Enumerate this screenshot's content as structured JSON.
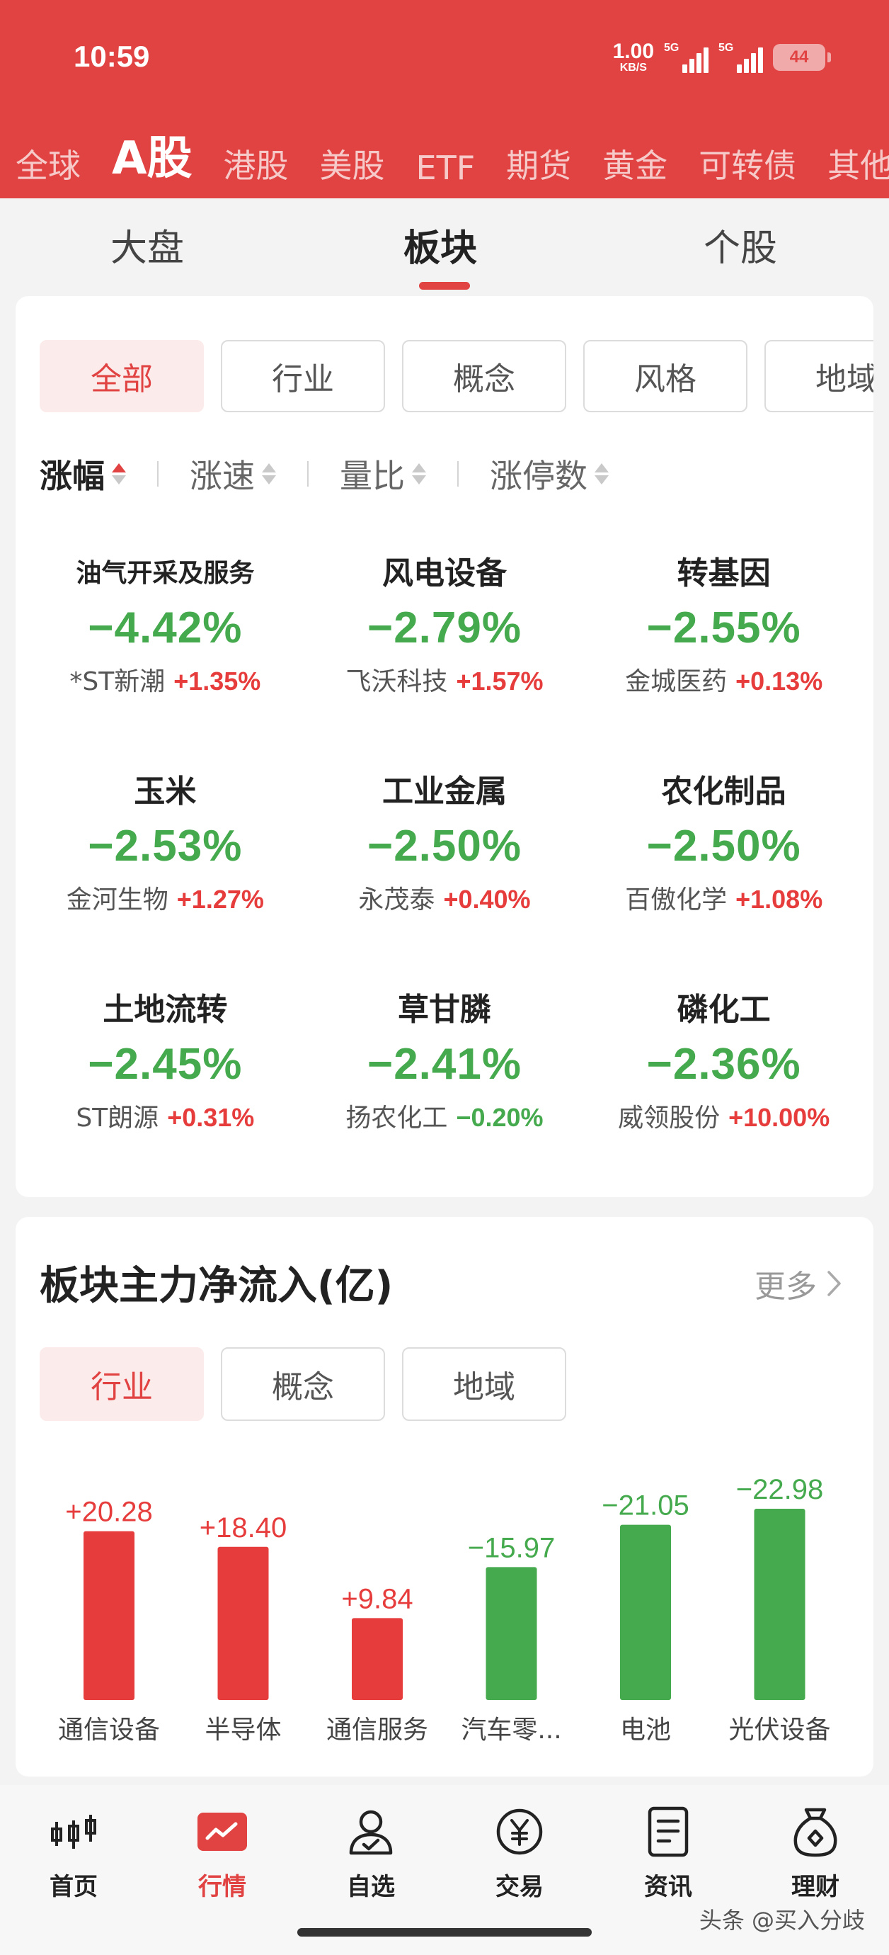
{
  "status_bar": {
    "time": "10:59",
    "net_speed_value": "1.00",
    "net_speed_unit": "KB/S",
    "signal1_label": "5G",
    "signal2_label": "5G",
    "battery": "44"
  },
  "market_tabs": [
    "全球",
    "A股",
    "港股",
    "美股",
    "ETF",
    "期货",
    "黄金",
    "可转债",
    "其他"
  ],
  "market_active": "A股",
  "sub_tabs": [
    "大盘",
    "板块",
    "个股"
  ],
  "sub_active": "板块",
  "filter_chips": [
    "全部",
    "行业",
    "概念",
    "风格",
    "地域"
  ],
  "sort_options": [
    "涨幅",
    "涨速",
    "量比",
    "涨停数"
  ],
  "sectors": [
    {
      "name": "油气开采及服务",
      "change": "−4.42%",
      "leader": "*ST新潮",
      "leader_change": "+1.35%"
    },
    {
      "name": "风电设备",
      "change": "−2.79%",
      "leader": "飞沃科技",
      "leader_change": "+1.57%"
    },
    {
      "name": "转基因",
      "change": "−2.55%",
      "leader": "金城医药",
      "leader_change": "+0.13%"
    },
    {
      "name": "玉米",
      "change": "−2.53%",
      "leader": "金河生物",
      "leader_change": "+1.27%"
    },
    {
      "name": "工业金属",
      "change": "−2.50%",
      "leader": "永茂泰",
      "leader_change": "+0.40%"
    },
    {
      "name": "农化制品",
      "change": "−2.50%",
      "leader": "百傲化学",
      "leader_change": "+1.08%"
    },
    {
      "name": "土地流转",
      "change": "−2.45%",
      "leader": "ST朗源",
      "leader_change": "+0.31%"
    },
    {
      "name": "草甘膦",
      "change": "−2.41%",
      "leader": "扬农化工",
      "leader_change": "−0.20%"
    },
    {
      "name": "磷化工",
      "change": "−2.36%",
      "leader": "威领股份",
      "leader_change": "+10.00%"
    }
  ],
  "flow_section": {
    "title": "板块主力净流入(亿)",
    "more": "更多",
    "chips": [
      "行业",
      "概念",
      "地域"
    ]
  },
  "chart_data": {
    "type": "bar",
    "categories": [
      "通信设备",
      "半导体",
      "通信服务",
      "汽车零...",
      "电池",
      "光伏设备"
    ],
    "values": [
      20.28,
      18.4,
      9.84,
      -15.97,
      -21.05,
      -22.98
    ],
    "labels": [
      "+20.28",
      "+18.40",
      "+9.84",
      "−15.97",
      "−21.05",
      "−22.98"
    ],
    "positive_color": "#e63c3c",
    "negative_color": "#45a94d",
    "note": "bar height shows absolute value"
  },
  "bottom_nav": [
    "首页",
    "行情",
    "自选",
    "交易",
    "资讯",
    "理财"
  ],
  "bottom_active": "行情",
  "watermark": "头条 @买入分歧",
  "colors": {
    "accent": "#e14343",
    "up": "#e63c3c",
    "down": "#45a94d"
  }
}
